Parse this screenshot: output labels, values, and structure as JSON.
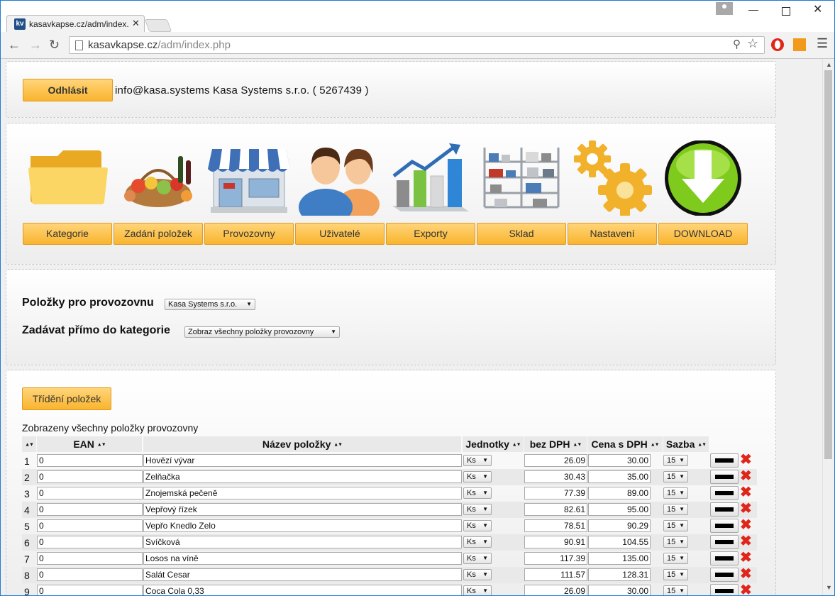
{
  "browser": {
    "tab_title": "kasavkapse.cz/adm/index.",
    "favicon": "kv",
    "url_host": "kasavkapse.cz",
    "url_path": "/adm/index.php"
  },
  "header": {
    "logout_label": "Odhlásit",
    "user_info": "info@kasa.systems Kasa Systems s.r.o. ( 5267439 )"
  },
  "nav": {
    "items": [
      {
        "label": "Kategorie",
        "icon": "folder-icon"
      },
      {
        "label": "Zadání položek",
        "icon": "groceries-icon"
      },
      {
        "label": "Provozovny",
        "icon": "shop-icon"
      },
      {
        "label": "Uživatelé",
        "icon": "users-icon"
      },
      {
        "label": "Exporty",
        "icon": "bar-chart-icon"
      },
      {
        "label": "Sklad",
        "icon": "warehouse-shelves-icon"
      },
      {
        "label": "Nastavení",
        "icon": "gears-icon"
      },
      {
        "label": "DOWNLOAD",
        "icon": "download-arrow-icon"
      }
    ]
  },
  "filter": {
    "location_label": "Položky pro provozovnu",
    "location_value": "Kasa Systems s.r.o.",
    "category_label": "Zadávat přímo do kategorie",
    "category_value": "Zobraz všechny položky provozovny"
  },
  "items": {
    "sort_label": "Třídění položek",
    "caption": "Zobrazeny všechny položky provozovny",
    "columns": {
      "ean": "EAN",
      "name": "Název položky",
      "unit": "Jednotky",
      "net": "bez DPH",
      "gross": "Cena s DPH",
      "vat": "Sazba"
    },
    "rows": [
      {
        "num": "1",
        "ean": "0",
        "name": "Hovězí vývar",
        "unit": "Ks",
        "net": "26.09",
        "gross": "30.00",
        "vat": "15"
      },
      {
        "num": "2",
        "ean": "0",
        "name": "Zelňačka",
        "unit": "Ks",
        "net": "30.43",
        "gross": "35.00",
        "vat": "15"
      },
      {
        "num": "3",
        "ean": "0",
        "name": "Znojemská pečeně",
        "unit": "Ks",
        "net": "77.39",
        "gross": "89.00",
        "vat": "15"
      },
      {
        "num": "4",
        "ean": "0",
        "name": "Vepřový řízek",
        "unit": "Ks",
        "net": "82.61",
        "gross": "95.00",
        "vat": "15"
      },
      {
        "num": "5",
        "ean": "0",
        "name": "Vepřo Knedlo Zelo",
        "unit": "Ks",
        "net": "78.51",
        "gross": "90.29",
        "vat": "15"
      },
      {
        "num": "6",
        "ean": "0",
        "name": "Svíčková",
        "unit": "Ks",
        "net": "90.91",
        "gross": "104.55",
        "vat": "15"
      },
      {
        "num": "7",
        "ean": "0",
        "name": "Losos na víně",
        "unit": "Ks",
        "net": "117.39",
        "gross": "135.00",
        "vat": "15"
      },
      {
        "num": "8",
        "ean": "0",
        "name": "Salát Cesar",
        "unit": "Ks",
        "net": "111.57",
        "gross": "128.31",
        "vat": "15"
      },
      {
        "num": "9",
        "ean": "0",
        "name": "Coca Cola 0,33",
        "unit": "Ks",
        "net": "26.09",
        "gross": "30.00",
        "vat": "15"
      }
    ]
  },
  "colors": {
    "button_top": "#ffd57a",
    "button_bottom": "#f9b42e",
    "delete": "#e0261b",
    "window_border": "#1f7bd6"
  }
}
